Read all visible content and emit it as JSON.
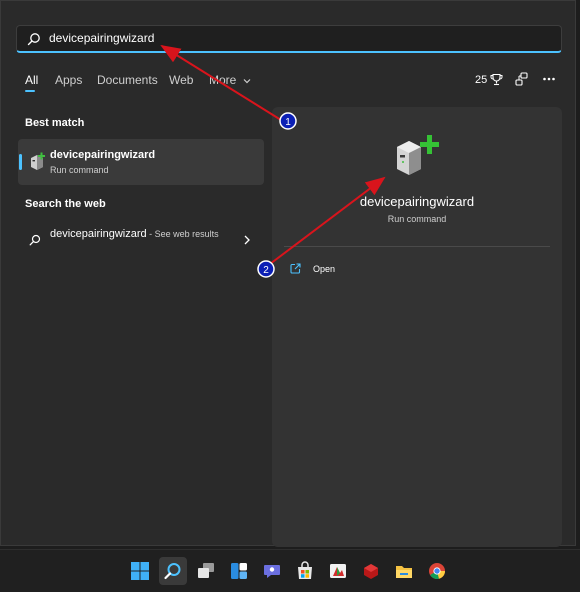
{
  "search": {
    "value": "devicepairingwizard"
  },
  "tabs": [
    {
      "label": "All",
      "active": true
    },
    {
      "label": "Apps"
    },
    {
      "label": "Documents"
    },
    {
      "label": "Web"
    },
    {
      "label": "More"
    }
  ],
  "rewards": {
    "points": "25",
    "icon": "trophy-icon"
  },
  "toolbar": {
    "share_icon": "network-icon",
    "more_icon": "ellipsis-icon"
  },
  "best_match": {
    "heading": "Best match",
    "title": "devicepairingwizard",
    "subtitle": "Run command"
  },
  "web": {
    "heading": "Search the web",
    "query": "devicepairingwizard",
    "suffix": " - See web results"
  },
  "detail": {
    "title": "devicepairingwizard",
    "subtitle": "Run command",
    "actions": [
      {
        "label": "Open",
        "icon": "open-external-icon"
      }
    ]
  },
  "annotations": [
    {
      "label": "1"
    },
    {
      "label": "2"
    }
  ],
  "colors": {
    "accent": "#4cc2ff",
    "annotation_arrow": "#d9141c",
    "annotation_badge": "#0b1fb5"
  },
  "taskbar": [
    {
      "icon": "start-icon"
    },
    {
      "icon": "search-icon",
      "active": true
    },
    {
      "icon": "task-view-icon"
    },
    {
      "icon": "widgets-icon"
    },
    {
      "icon": "chat-icon"
    },
    {
      "icon": "store-icon"
    },
    {
      "icon": "app-icon"
    },
    {
      "icon": "app-icon"
    },
    {
      "icon": "file-explorer-icon"
    },
    {
      "icon": "chrome-icon"
    }
  ]
}
